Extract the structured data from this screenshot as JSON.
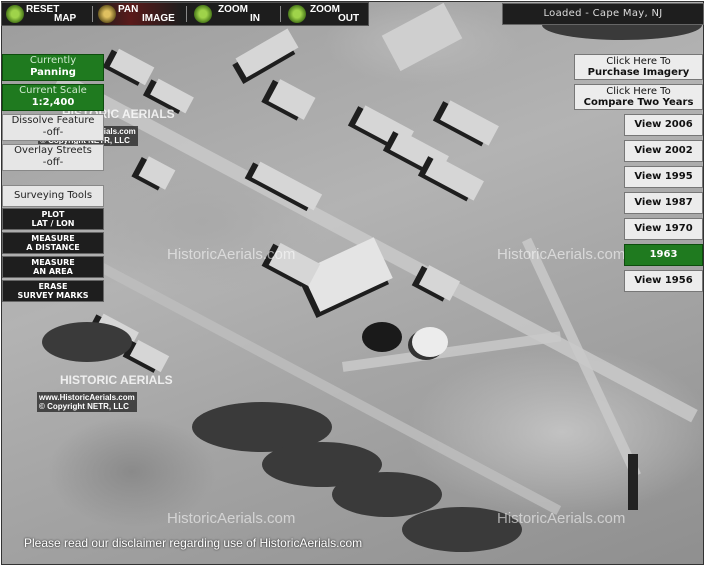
{
  "toolbar": {
    "reset": {
      "line1": "RESET",
      "line2": "MAP"
    },
    "pan": {
      "line1": "PAN",
      "line2": "IMAGE"
    },
    "zoom_in": {
      "line1": "ZOOM",
      "line2": "IN"
    },
    "zoom_out": {
      "line1": "ZOOM",
      "line2": "OUT"
    }
  },
  "status": "Loaded - Cape May, NJ",
  "left_panel": {
    "mode_label": "Currently",
    "mode_value": "Panning",
    "scale_label": "Current Scale",
    "scale_value": "1:2,400",
    "dissolve_label": "Dissolve Feature",
    "dissolve_value": "-off-",
    "overlay_label": "Overlay Streets",
    "overlay_value": "-off-",
    "surveying_title": "Surveying Tools",
    "tools": [
      {
        "line1": "PLOT",
        "line2": "LAT / LON"
      },
      {
        "line1": "MEASURE",
        "line2": "A DISTANCE"
      },
      {
        "line1": "MEASURE",
        "line2": "AN AREA"
      },
      {
        "line1": "ERASE",
        "line2": "SURVEY MARKS"
      }
    ]
  },
  "right_panel": {
    "purchase": {
      "line1": "Click Here To",
      "line2": "Purchase Imagery"
    },
    "compare": {
      "line1": "Click Here To",
      "line2": "Compare Two Years"
    },
    "years": [
      {
        "label": "View 2006",
        "selected": false
      },
      {
        "label": "View 2002",
        "selected": false
      },
      {
        "label": "View 1995",
        "selected": false
      },
      {
        "label": "View 1987",
        "selected": false
      },
      {
        "label": "View 1970",
        "selected": false
      },
      {
        "label": "1963",
        "selected": true
      },
      {
        "label": "View 1956",
        "selected": false
      }
    ]
  },
  "watermarks": {
    "site": "HistoricAerials.com",
    "logo": "HISTORIC AERIALS",
    "copy_line1": "www.HistoricAerials.com",
    "copy_line2": "© Copyright NETR, LLC"
  },
  "disclaimer": "Please read our disclaimer regarding use of HistoricAerials.com",
  "colors": {
    "selected_green": "#1f7a1f",
    "toolbar_bg": "#1d1d1d"
  }
}
